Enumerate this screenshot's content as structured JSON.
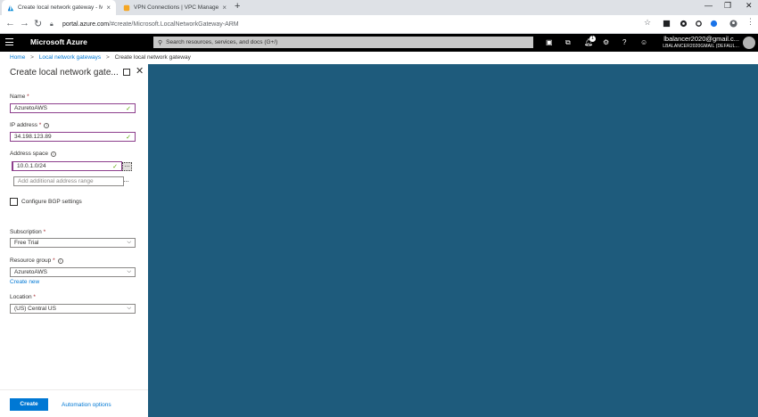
{
  "browser": {
    "tabs": [
      {
        "title": "Create local network gateway - M",
        "active": true,
        "favicon": "azure-icon"
      },
      {
        "title": "VPN Connections | VPC Managem",
        "active": false,
        "favicon": "aws-icon"
      }
    ],
    "url_host": "portal.azure.com",
    "url_path": "/#create/Microsoft.LocalNetworkGateway-ARM"
  },
  "azure_bar": {
    "brand": "Microsoft Azure",
    "search_placeholder": "Search resources, services, and docs (G+/)",
    "notification_count": "1",
    "account_user": "lbalancer2020@gmail.c...",
    "account_tenant": "LBALANCER2020GMAIL (DEFAUL..."
  },
  "breadcrumb": {
    "home": "Home",
    "parent": "Local network gateways",
    "current": "Create local network gateway",
    "separator": ">"
  },
  "blade": {
    "title": "Create local network gate...",
    "name_label": "Name",
    "name_value": "AzuretoAWS",
    "ip_label": "IP address",
    "ip_value": "34.198.123.89",
    "address_space_label": "Address space",
    "address_space_value": "10.0.1.0/24",
    "add_range_placeholder": "Add additional address range",
    "bgp_label": "Configure BGP settings",
    "subscription_label": "Subscription",
    "subscription_value": "Free Trial",
    "resource_group_label": "Resource group",
    "resource_group_value": "AzuretoAWS",
    "create_new_link": "Create new",
    "location_label": "Location",
    "location_value": "(US) Central US",
    "create_button": "Create",
    "automation_link": "Automation options",
    "required_mark": "*"
  },
  "colors": {
    "accent": "#0078d4",
    "right_pane": "#1e5b7c",
    "azure_bar": "#000000",
    "valid_check": "#57a300"
  }
}
